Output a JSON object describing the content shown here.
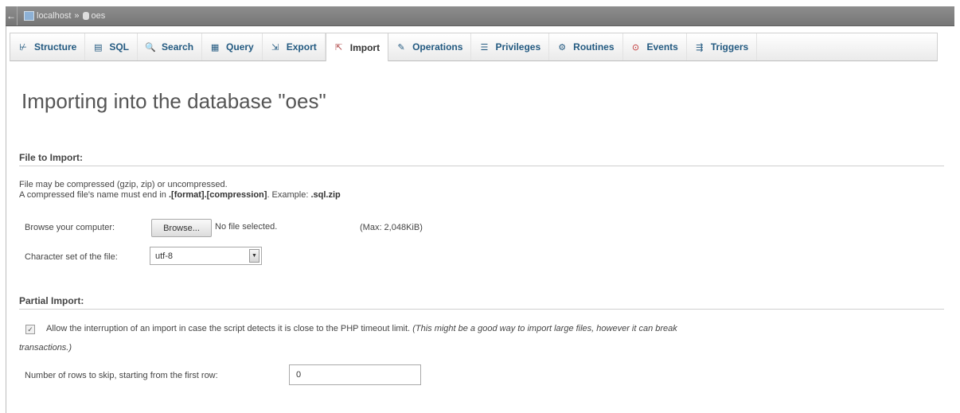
{
  "breadcrumb": {
    "server": "localhost",
    "separator": "»",
    "database": "oes",
    "collapse_symbol": "←"
  },
  "tabs": [
    {
      "label": "Structure",
      "icon": "structure-icon",
      "glyph": "⊬"
    },
    {
      "label": "SQL",
      "icon": "sql-icon",
      "glyph": "▤"
    },
    {
      "label": "Search",
      "icon": "search-icon",
      "glyph": "🔍"
    },
    {
      "label": "Query",
      "icon": "query-icon",
      "glyph": "▦"
    },
    {
      "label": "Export",
      "icon": "export-icon",
      "glyph": "⇲"
    },
    {
      "label": "Import",
      "icon": "import-icon",
      "glyph": "⇱",
      "active": true
    },
    {
      "label": "Operations",
      "icon": "operations-icon",
      "glyph": "✎"
    },
    {
      "label": "Privileges",
      "icon": "privileges-icon",
      "glyph": "☰"
    },
    {
      "label": "Routines",
      "icon": "routines-icon",
      "glyph": "⚙"
    },
    {
      "label": "Events",
      "icon": "events-icon",
      "glyph": "⊙"
    },
    {
      "label": "Triggers",
      "icon": "triggers-icon",
      "glyph": "⇶"
    }
  ],
  "page": {
    "title": "Importing into the database \"oes\""
  },
  "file_to_import": {
    "legend": "File to Import:",
    "line1": "File may be compressed (gzip, zip) or uncompressed.",
    "line2_prefix": "A compressed file's name must end in ",
    "line2_format": ".[format].[compression]",
    "line2_example_label": ". Example: ",
    "line2_example": ".sql.zip",
    "browse_label": "Browse your computer:",
    "browse_button": "Browse...",
    "no_file": "No file selected.",
    "max_size": "(Max: 2,048KiB)",
    "charset_label": "Character set of the file:",
    "charset_value": "utf-8"
  },
  "partial_import": {
    "legend": "Partial Import:",
    "allow_interrupt_text": "Allow the interruption of an import in case the script detects it is close to the PHP timeout limit.",
    "allow_interrupt_note_line1": "(This might be a good way to import large files, however it can break",
    "allow_interrupt_note_line2": "transactions.)",
    "allow_interrupt_checked": true,
    "skip_rows_label": "Number of rows to skip, starting from the first row:",
    "skip_rows_value": "0"
  }
}
